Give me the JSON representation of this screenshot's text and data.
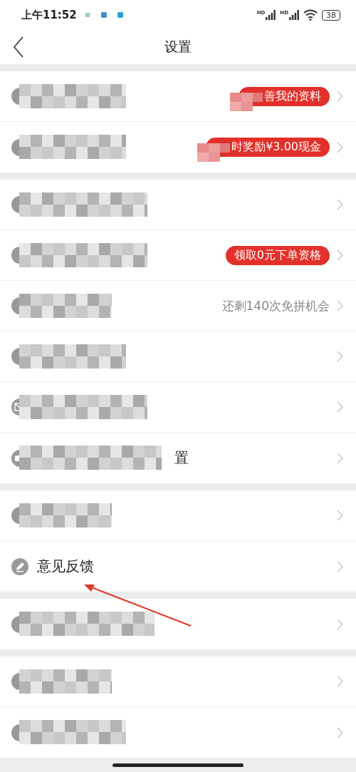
{
  "status_bar": {
    "time": "上午11:52",
    "signal_labels": [
      "HD",
      "HD"
    ],
    "battery": "38"
  },
  "nav": {
    "title": "设置"
  },
  "groups": [
    {
      "rows": [
        {
          "kind": "badge",
          "redacted": true,
          "badge": "善我的资料",
          "badge_redacted": true
        },
        {
          "kind": "badge",
          "redacted": true,
          "badge": "时奖励¥3.00现金",
          "badge_redacted": true
        }
      ]
    },
    {
      "rows": [
        {
          "kind": "plain",
          "redacted": true
        },
        {
          "kind": "badge",
          "redacted": true,
          "badge": "领取0元下单资格",
          "badge_redacted": false
        },
        {
          "kind": "hint",
          "redacted": true,
          "hint": "还剩140次免拼机会"
        },
        {
          "kind": "plain",
          "redacted": true
        },
        {
          "kind": "plain",
          "redacted": true
        },
        {
          "kind": "plain",
          "redacted": true,
          "label": "置"
        }
      ]
    },
    {
      "rows": [
        {
          "kind": "plain",
          "redacted": true
        },
        {
          "kind": "plain",
          "redacted": false,
          "label": "意见反馈"
        }
      ]
    },
    {
      "rows": [
        {
          "kind": "plain",
          "redacted": true
        }
      ]
    },
    {
      "rows": [
        {
          "kind": "plain",
          "redacted": true
        },
        {
          "kind": "plain",
          "redacted": true
        }
      ]
    }
  ],
  "annotation": {
    "kind": "arrow"
  }
}
